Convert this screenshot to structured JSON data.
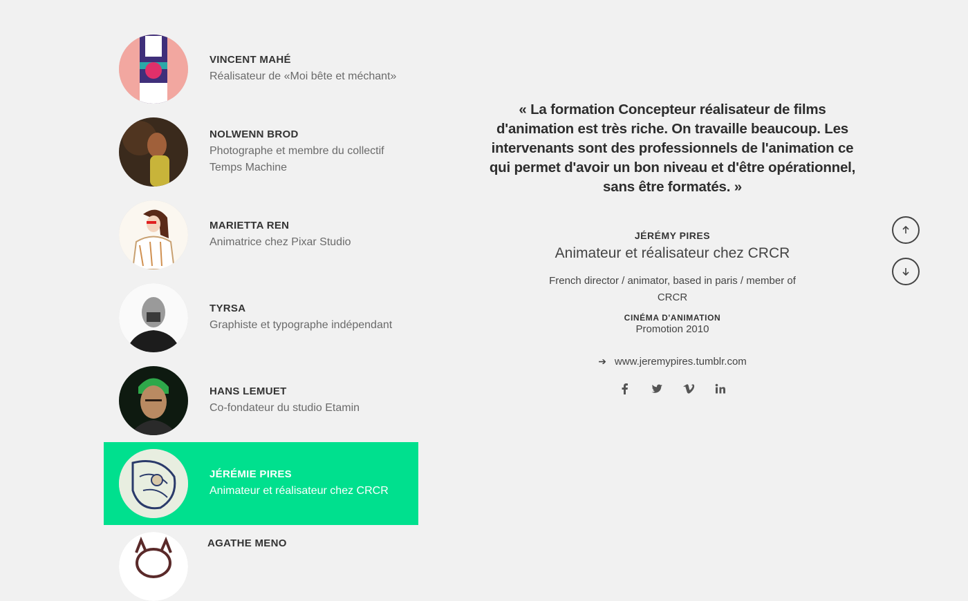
{
  "people": [
    {
      "name": "VINCENT MAHÉ",
      "role": "Réalisateur de «Moi bête et méchant»"
    },
    {
      "name": "NOLWENN BROD",
      "role": "Photographe et membre du collectif Temps Machine"
    },
    {
      "name": "MARIETTA REN",
      "role": "Animatrice chez Pixar Studio"
    },
    {
      "name": "TYRSA",
      "role": "Graphiste et typographe indépendant"
    },
    {
      "name": "HANS LEMUET",
      "role": "Co-fondateur du studio Etamin"
    },
    {
      "name": "JÉRÉMIE PIRES",
      "role": "Animateur et réalisateur chez CRCR"
    },
    {
      "name": "AGATHE MENO",
      "role": ""
    }
  ],
  "detail": {
    "quote": "« La formation Concepteur réalisateur de films d'animation est très riche. On travaille beaucoup. Les intervenants sont des professionnels de l'animation ce qui permet d'avoir un bon niveau et d'être opérationnel, sans être formatés. »",
    "name": "JÉRÉMY PIRES",
    "role": "Animateur et réalisateur chez CRCR",
    "bio": "French director / animator, based in paris / member of CRCR",
    "category": "CINÉMA D'ANIMATION",
    "promotion": "Promotion 2010",
    "link": "www.jeremypires.tumblr.com"
  },
  "colors": {
    "active": "#00e08e",
    "background": "#f1f1f1"
  },
  "icons": [
    "arrow-up-icon",
    "arrow-down-icon",
    "arrow-right-icon",
    "facebook-icon",
    "twitter-icon",
    "vimeo-icon",
    "linkedin-icon"
  ]
}
